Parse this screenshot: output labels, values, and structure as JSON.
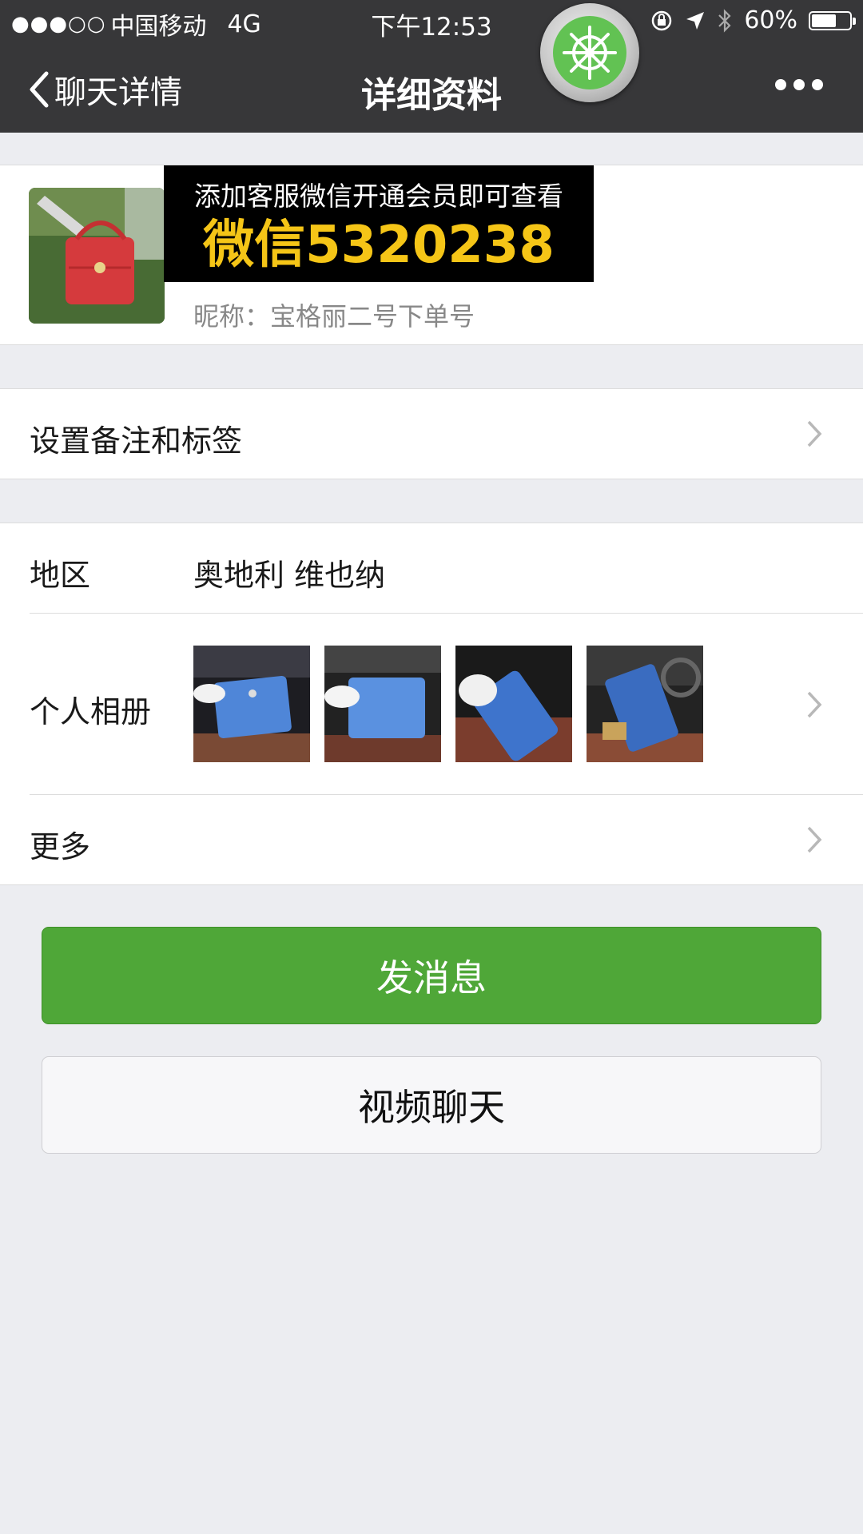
{
  "status_bar": {
    "signal_dots": "●●●○○",
    "carrier": "中国移动",
    "network": "4G",
    "time": "下午12:53",
    "battery_text": "60%",
    "battery_level": 0.6
  },
  "nav": {
    "back_label": "聊天详情",
    "title": "详细资料",
    "more_icon": "more-dots-icon"
  },
  "profile": {
    "nickname": "昵称：宝格丽二号下单号",
    "ad_line1": "添加客服微信开通会员即可查看",
    "ad_line2": "微信5320238"
  },
  "rows": {
    "remark": "设置备注和标签",
    "region_label": "地区",
    "region_value": "奥地利 维也纳",
    "album_label": "个人相册",
    "more": "更多"
  },
  "buttons": {
    "message": "发消息",
    "video": "视频聊天"
  },
  "colors": {
    "nav_bg": "#373739",
    "accent_green": "#4fa738",
    "page_bg": "#ecedf1",
    "ad_yellow": "#f5c517"
  }
}
